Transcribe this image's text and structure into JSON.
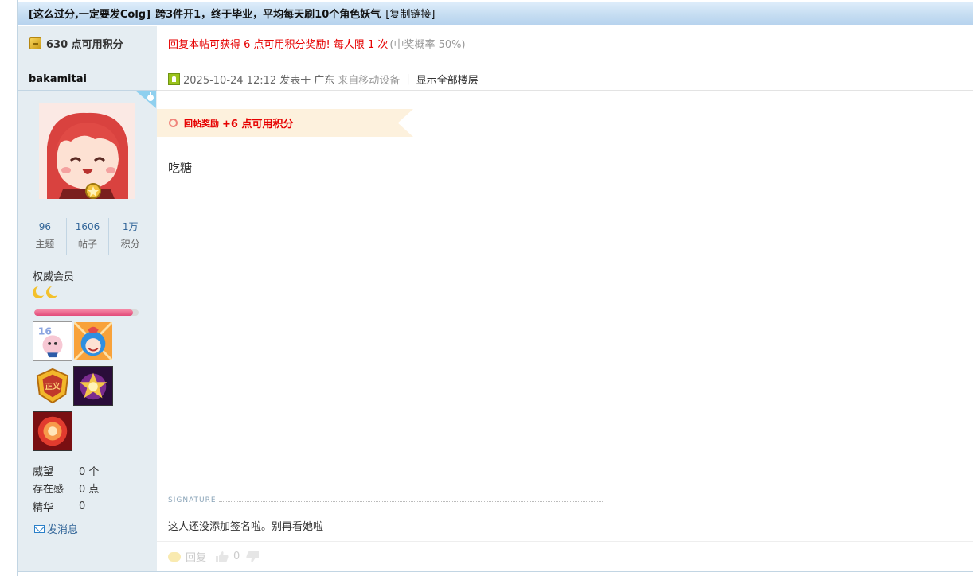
{
  "thread": {
    "title_tag": "[这么过分,一定要发Colg]",
    "title": "跨3件开1，终于毕业，平均每天刷10个角色妖气",
    "copy_link": "[复制链接]"
  },
  "points": {
    "text": "630 点可用积分"
  },
  "reward_banner": {
    "text": "回复本帖可获得 6 点可用积分奖励! 每人限 1 次",
    "prob": "(中奖概率 50%)"
  },
  "user": {
    "name": "bakamitai",
    "stats": [
      {
        "num": "96",
        "label": "主题"
      },
      {
        "num": "1606",
        "label": "帖子"
      },
      {
        "num": "1万",
        "label": "积分"
      }
    ],
    "rank": "权威会员",
    "level_progress_pct": 95,
    "profile": [
      {
        "k": "威望",
        "v": "0 个"
      },
      {
        "k": "存在感",
        "v": "0 点"
      },
      {
        "k": "精华",
        "v": "0"
      }
    ],
    "pm": "发消息"
  },
  "post": {
    "date": "2025-10-24 12:12 发表于",
    "location": "广东",
    "device": "来自移动设备",
    "show_all": "显示全部楼层",
    "reply_reward_label": "回帖奖励",
    "reply_reward_value": "+6 点可用积分",
    "body": "吃糖",
    "signature_label": "SIGNATURE",
    "signature": "这人还没添加签名啦。别再看她啦",
    "reply_label": "回复",
    "like_count": "0"
  },
  "colors": {
    "accent_red": "#e60000",
    "link_blue": "#336699",
    "sidebar_bg": "#e5edf2"
  }
}
